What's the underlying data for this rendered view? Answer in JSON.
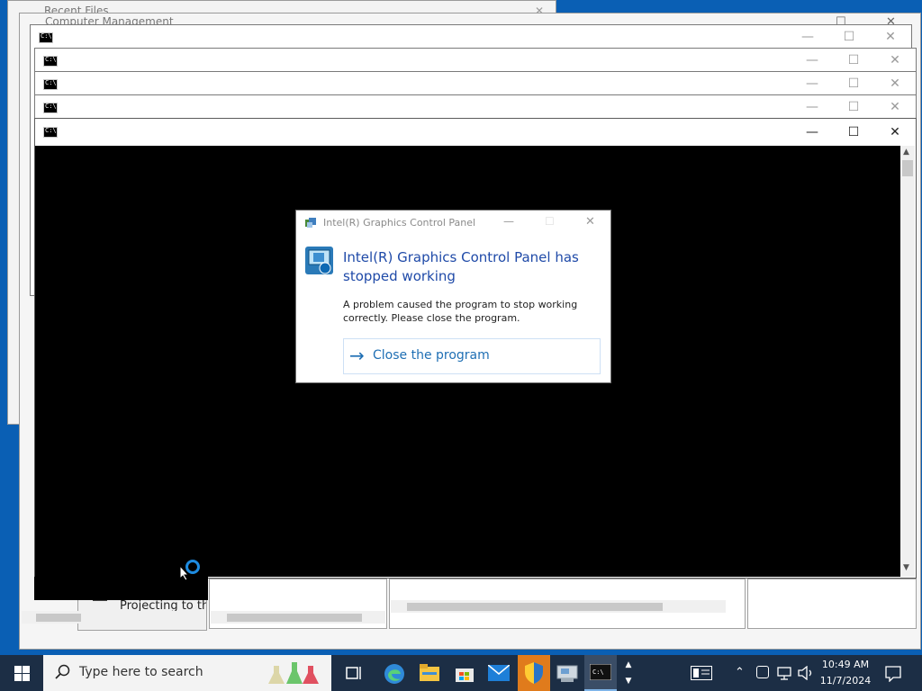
{
  "windows": {
    "back_title": "Computer Management",
    "back2_title": "Recent Files",
    "cmd_icon_label": "C:\\",
    "controls": {
      "minimize": "—",
      "maximize": "☐",
      "close": "✕"
    }
  },
  "dialog": {
    "title": "Intel(R) Graphics Control Panel",
    "heading": "Intel(R) Graphics Control Panel has stopped working",
    "body": "A problem caused the program to stop working correctly. Please close the program.",
    "close_label": "Close the program",
    "arrow": "→",
    "minimize": "—",
    "maximize": "☐",
    "close": "✕"
  },
  "background_panel": {
    "projecting_label": "Projecting to th"
  },
  "taskbar": {
    "search_placeholder": "Type here to search",
    "time": "10:49 AM",
    "date": "11/7/2024",
    "icons": [
      "windows-start-icon",
      "task-view-icon",
      "edge-icon",
      "file-explorer-icon",
      "store-icon",
      "mail-icon",
      "shield-icon",
      "server-manager-icon",
      "cmd-icon"
    ]
  },
  "colors": {
    "desktop": "#0a5fb4",
    "taskbar": "#1c2e45",
    "dialog_heading": "#1f4aa8",
    "link": "#1f6fb4"
  }
}
